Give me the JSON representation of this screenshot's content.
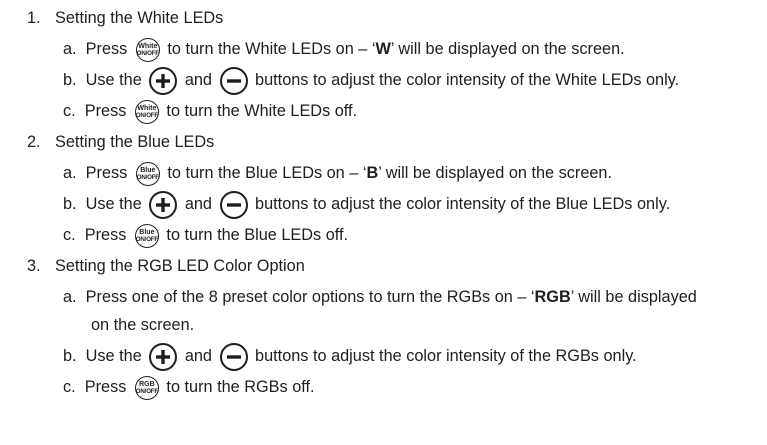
{
  "sections": [
    {
      "number": "1.",
      "heading": "Setting the White LEDs",
      "steps": [
        {
          "letter": "a.",
          "before": "Press",
          "button_top": "White",
          "button_bottom": "ON/OFF",
          "mid": "to turn the White LEDs on – ‘",
          "bold": "W",
          "after": "’ will be displayed on the screen."
        },
        {
          "letter": "b.",
          "before": "Use the",
          "plus_icon": "plus-icon",
          "and": "and",
          "minus_icon": "minus-icon",
          "after": "buttons to adjust the color intensity of the White LEDs only."
        },
        {
          "letter": "c.",
          "before": "Press",
          "button_top": "White",
          "button_bottom": "ON/OFF",
          "after": "to turn the White LEDs off."
        }
      ]
    },
    {
      "number": "2.",
      "heading": "Setting the Blue LEDs",
      "steps": [
        {
          "letter": "a.",
          "before": "Press",
          "button_top": "Blue",
          "button_bottom": "ON/OFF",
          "mid": "to turn the Blue LEDs on – ‘",
          "bold": "B",
          "after": "’ will be displayed on the screen."
        },
        {
          "letter": "b.",
          "before": "Use the",
          "plus_icon": "plus-icon",
          "and": "and",
          "minus_icon": "minus-icon",
          "after": "buttons to adjust the color intensity of the Blue LEDs only."
        },
        {
          "letter": "c.",
          "before": "Press",
          "button_top": "Blue",
          "button_bottom": "ON/OFF",
          "after": "to turn the Blue LEDs off."
        }
      ]
    },
    {
      "number": "3.",
      "heading": "Setting the RGB LED Color Option",
      "steps": [
        {
          "letter": "a.",
          "line1_before": "Press one of the 8 preset color options to turn the RGBs on – ‘",
          "bold": "RGB",
          "line1_after": "’ will be displayed",
          "line2": "on the screen."
        },
        {
          "letter": "b.",
          "before": "Use the",
          "plus_icon": "plus-icon",
          "and": "and",
          "minus_icon": "minus-icon",
          "after": "buttons to adjust the color intensity of the RGBs only."
        },
        {
          "letter": "c.",
          "before": "Press",
          "button_top": "RGB",
          "button_bottom": "ON/OFF",
          "after": "to turn the RGBs off."
        }
      ]
    }
  ]
}
